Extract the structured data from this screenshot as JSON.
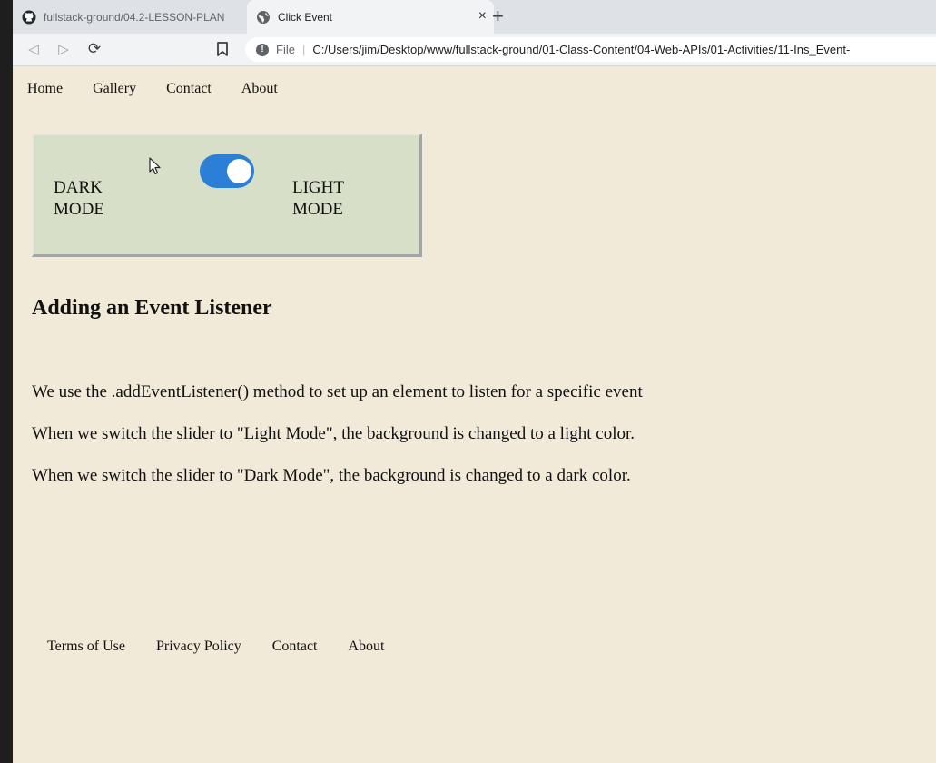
{
  "browser": {
    "tabs": [
      {
        "title": "fullstack-ground/04.2-LESSON-PLAN",
        "icon": "github-icon",
        "active": false
      },
      {
        "title": "Click Event",
        "icon": "globe-icon",
        "active": true
      }
    ],
    "tab_close": "×",
    "new_tab": "+",
    "address": {
      "scheme": "File",
      "url": "C:/Users/jim/Desktop/www/fullstack-ground/01-Class-Content/04-Web-APIs/01-Activities/11-Ins_Event-"
    }
  },
  "nav": {
    "items": [
      "Home",
      "Gallery",
      "Contact",
      "About"
    ]
  },
  "mode_toggle": {
    "dark_label": "DARK MODE",
    "light_label": "LIGHT MODE",
    "accent": "#2b7fd6"
  },
  "main": {
    "heading": "Adding an Event Listener",
    "paragraphs": [
      "We use the .addEventListener() method to set up an element to listen for a specific event",
      "When we switch the slider to \"Light Mode\", the background is changed to a light color.",
      "When we switch the slider to \"Dark Mode\", the background is changed to a dark color."
    ]
  },
  "footer": {
    "links": [
      "Terms of Use",
      "Privacy Policy",
      "Contact",
      "About"
    ]
  },
  "colors": {
    "page_background": "#f2ead9",
    "panel_background": "#d8dfc8"
  }
}
